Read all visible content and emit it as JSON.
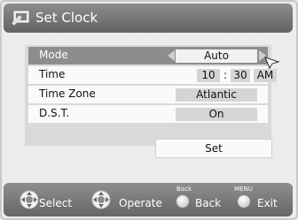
{
  "header": {
    "title": "Set Clock",
    "icon": "clock-settings-icon"
  },
  "rows": [
    {
      "label": "Mode",
      "value": "Auto"
    },
    {
      "label": "Time",
      "hour": "10",
      "separator": ":",
      "minute": "30",
      "ampm": "AM"
    },
    {
      "label": "Time Zone",
      "value": "Atlantic"
    },
    {
      "label": "D.S.T.",
      "value": "On"
    }
  ],
  "set_button": "Set",
  "footer": {
    "select": "Select",
    "operate": "Operate",
    "back_key": "Back",
    "back": "Back",
    "exit_key": "MENU",
    "exit": "Exit"
  }
}
